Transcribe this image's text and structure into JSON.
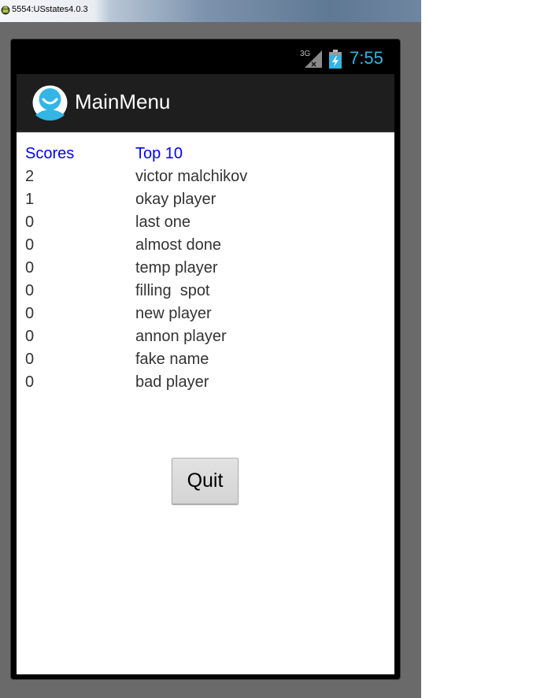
{
  "window": {
    "title": "5554:USstates4.0.3"
  },
  "status_bar": {
    "network": "3G",
    "time": "7:55",
    "signal_icon": "signal-icon",
    "battery_icon": "battery-charging-icon"
  },
  "action_bar": {
    "title": "MainMenu",
    "app_icon": "app-avatar-icon"
  },
  "scores": {
    "headers": {
      "score": "Scores",
      "name": "Top 10"
    },
    "rows": [
      {
        "score": "2",
        "name": "victor malchikov"
      },
      {
        "score": "1",
        "name": "okay player"
      },
      {
        "score": "0",
        "name": "last one"
      },
      {
        "score": "0",
        "name": "almost done"
      },
      {
        "score": "0",
        "name": "temp player"
      },
      {
        "score": "0",
        "name": "filling  spot"
      },
      {
        "score": "0",
        "name": "new player"
      },
      {
        "score": "0",
        "name": "annon player"
      },
      {
        "score": "0",
        "name": "fake name"
      },
      {
        "score": "0",
        "name": "bad player"
      }
    ]
  },
  "buttons": {
    "quit_label": "Quit"
  },
  "colors": {
    "header_text": "#0000ff",
    "clock": "#33b5e5",
    "action_bar_bg": "#1e1e1e"
  }
}
